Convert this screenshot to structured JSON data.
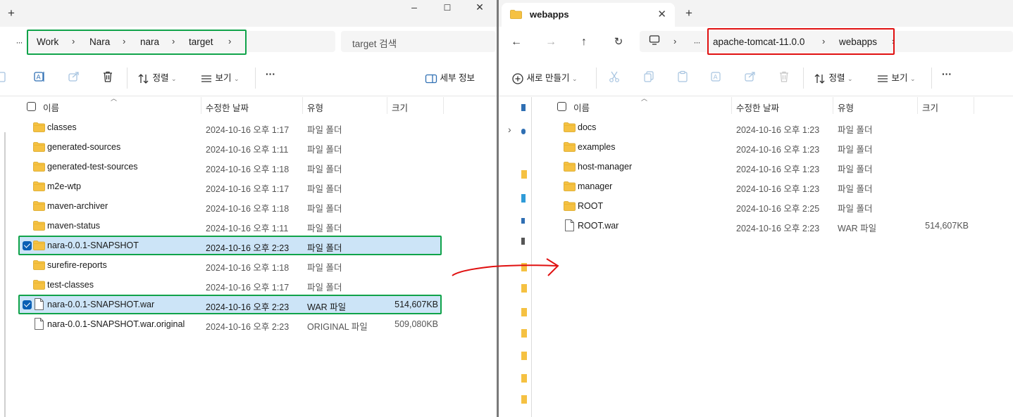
{
  "left": {
    "window_controls": {
      "new_tab": "+",
      "minimize": "–",
      "maximize": "☐",
      "close": "✕"
    },
    "overflow": "···",
    "breadcrumb": [
      "Work",
      "Nara",
      "nara",
      "target"
    ],
    "search_placeholder": "target 검색",
    "toolbar": {
      "sort": "정렬",
      "view": "보기",
      "more": "···",
      "details": "세부 정보"
    },
    "columns": {
      "name": "이름",
      "date": "수정한 날짜",
      "type": "유형",
      "size": "크기"
    },
    "rows": [
      {
        "name": "classes",
        "date": "2024-10-16 오후 1:17",
        "type": "파일 폴더",
        "size": "",
        "kind": "folder",
        "selected": false
      },
      {
        "name": "generated-sources",
        "date": "2024-10-16 오후 1:11",
        "type": "파일 폴더",
        "size": "",
        "kind": "folder",
        "selected": false
      },
      {
        "name": "generated-test-sources",
        "date": "2024-10-16 오후 1:18",
        "type": "파일 폴더",
        "size": "",
        "kind": "folder",
        "selected": false
      },
      {
        "name": "m2e-wtp",
        "date": "2024-10-16 오후 1:17",
        "type": "파일 폴더",
        "size": "",
        "kind": "folder",
        "selected": false
      },
      {
        "name": "maven-archiver",
        "date": "2024-10-16 오후 1:18",
        "type": "파일 폴더",
        "size": "",
        "kind": "folder",
        "selected": false
      },
      {
        "name": "maven-status",
        "date": "2024-10-16 오후 1:11",
        "type": "파일 폴더",
        "size": "",
        "kind": "folder",
        "selected": false
      },
      {
        "name": "nara-0.0.1-SNAPSHOT",
        "date": "2024-10-16 오후 2:23",
        "type": "파일 폴더",
        "size": "",
        "kind": "folder",
        "selected": true
      },
      {
        "name": "surefire-reports",
        "date": "2024-10-16 오후 1:18",
        "type": "파일 폴더",
        "size": "",
        "kind": "folder",
        "selected": false
      },
      {
        "name": "test-classes",
        "date": "2024-10-16 오후 1:17",
        "type": "파일 폴더",
        "size": "",
        "kind": "folder",
        "selected": false
      },
      {
        "name": "nara-0.0.1-SNAPSHOT.war",
        "date": "2024-10-16 오후 2:23",
        "type": "WAR 파일",
        "size": "514,607KB",
        "kind": "file",
        "selected": true
      },
      {
        "name": "nara-0.0.1-SNAPSHOT.war.original",
        "date": "2024-10-16 오후 2:23",
        "type": "ORIGINAL 파일",
        "size": "509,080KB",
        "kind": "file",
        "selected": false
      }
    ]
  },
  "right": {
    "tab_title": "webapps",
    "tab_close": "✕",
    "new_tab": "+",
    "overflow": "···",
    "breadcrumb": [
      "apache-tomcat-11.0.0",
      "webapps"
    ],
    "toolbar": {
      "new": "새로 만들기",
      "sort": "정렬",
      "view": "보기",
      "more": "···"
    },
    "columns": {
      "name": "이름",
      "date": "수정한 날짜",
      "type": "유형",
      "size": "크기"
    },
    "rows": [
      {
        "name": "docs",
        "date": "2024-10-16 오후 1:23",
        "type": "파일 폴더",
        "size": "",
        "kind": "folder"
      },
      {
        "name": "examples",
        "date": "2024-10-16 오후 1:23",
        "type": "파일 폴더",
        "size": "",
        "kind": "folder"
      },
      {
        "name": "host-manager",
        "date": "2024-10-16 오후 1:23",
        "type": "파일 폴더",
        "size": "",
        "kind": "folder"
      },
      {
        "name": "manager",
        "date": "2024-10-16 오후 1:23",
        "type": "파일 폴더",
        "size": "",
        "kind": "folder"
      },
      {
        "name": "ROOT",
        "date": "2024-10-16 오후 2:25",
        "type": "파일 폴더",
        "size": "",
        "kind": "folder"
      },
      {
        "name": "ROOT.war",
        "date": "2024-10-16 오후 2:23",
        "type": "WAR 파일",
        "size": "514,607KB",
        "kind": "file"
      }
    ]
  },
  "colors": {
    "folder": "#f5c142",
    "selected_row": "#cce4f7",
    "highlight_green": "#10a34a",
    "highlight_red": "#e01010",
    "annotation_arrow": "#e01010"
  }
}
